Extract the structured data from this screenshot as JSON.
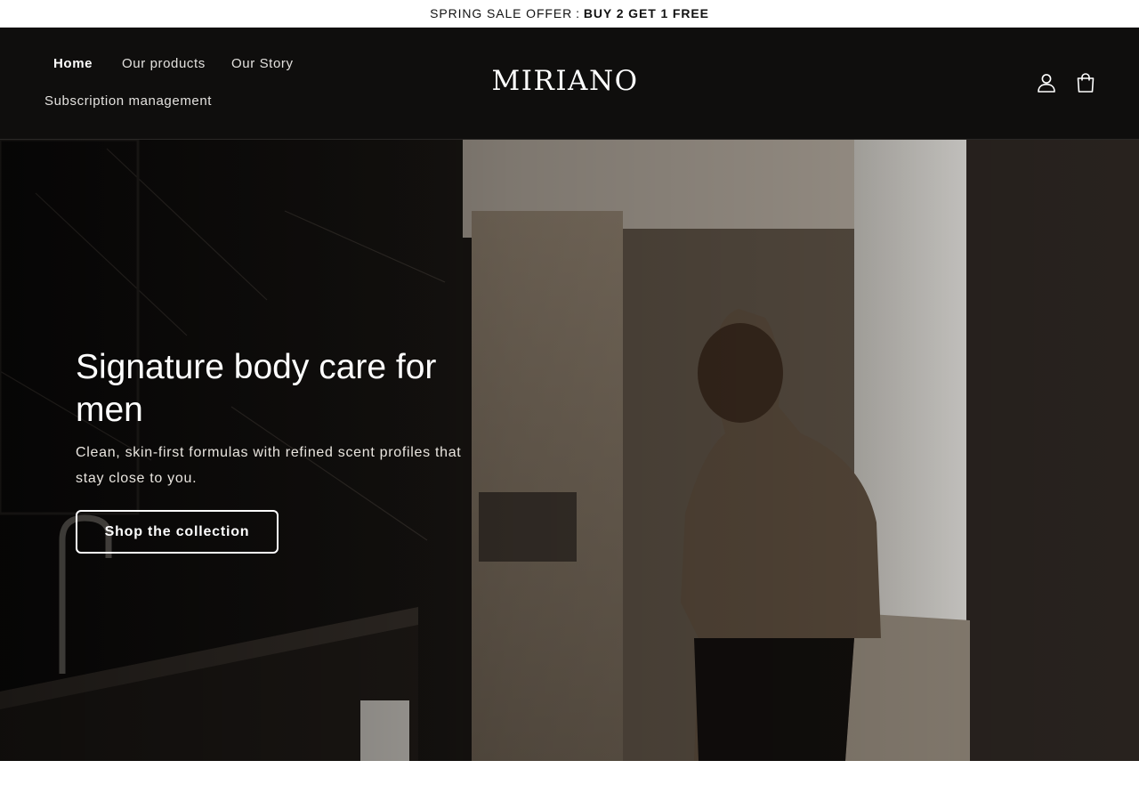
{
  "announcement": {
    "prefix": "SPRING SALE OFFER",
    "separator": ":",
    "offer": "BUY 2 GET 1 FREE"
  },
  "header": {
    "nav": {
      "home": "Home",
      "products": "Our products",
      "story": "Our Story",
      "subscription": "Subscription management"
    },
    "logo": "MIRIANO",
    "icons": {
      "account": "account-icon",
      "cart": "cart-icon"
    }
  },
  "hero": {
    "title": "Signature body care for men",
    "subtitle": "Clean, skin-first formulas with refined scent profiles that stay close to you.",
    "cta": "Shop the collection"
  },
  "colors": {
    "header_bg": "#0f0e0d",
    "hero_tone": "#6d6254",
    "text_light": "#ffffff"
  }
}
